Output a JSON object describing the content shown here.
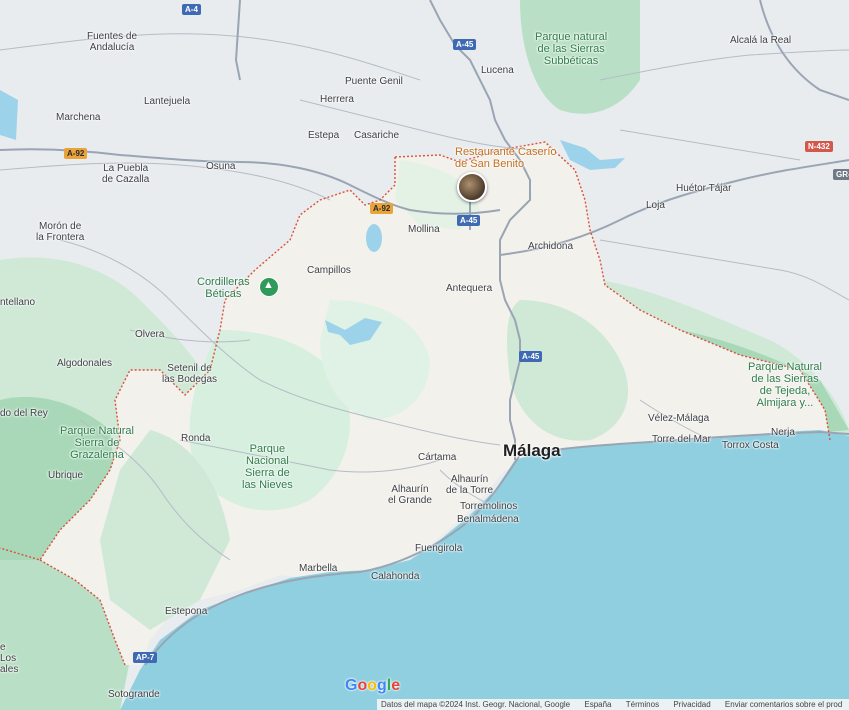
{
  "map": {
    "focus_city": "Málaga",
    "colors": {
      "sea": "#8fcfe0",
      "land": "#e9ecef",
      "province": "#f3f1ec",
      "green": "#bfe6cf",
      "dark_green": "#9fd5b2",
      "road": "#9aa5b4",
      "border": "#d9503c",
      "water": "#9dd3ea"
    },
    "cities": [
      {
        "id": "malaga",
        "name": "Málaga"
      },
      {
        "id": "antequera",
        "name": "Antequera"
      },
      {
        "id": "marbella",
        "name": "Marbella"
      },
      {
        "id": "ronda",
        "name": "Ronda"
      },
      {
        "id": "velez",
        "name": "Vélez-Málaga"
      },
      {
        "id": "torremolinos",
        "name": "Torremolinos"
      },
      {
        "id": "benalmadena",
        "name": "Benalmádena"
      },
      {
        "id": "fuengirola",
        "name": "Fuengirola"
      },
      {
        "id": "calahonda",
        "name": "Calahonda"
      },
      {
        "id": "estepona",
        "name": "Estepona"
      },
      {
        "id": "sotogrande",
        "name": "Sotogrande"
      },
      {
        "id": "cartama",
        "name": "Cártama"
      },
      {
        "id": "alhaurin_grande",
        "name": "Alhaurín\nel Grande"
      },
      {
        "id": "alhaurin_torre",
        "name": "Alhaurín\nde la Torre"
      },
      {
        "id": "nerja",
        "name": "Nerja"
      },
      {
        "id": "torre_mar",
        "name": "Torre del Mar"
      },
      {
        "id": "torrox",
        "name": "Torrox Costa"
      },
      {
        "id": "archidona",
        "name": "Archidona"
      },
      {
        "id": "mollina",
        "name": "Mollina"
      },
      {
        "id": "campillos",
        "name": "Campillos"
      },
      {
        "id": "olvera",
        "name": "Olvera"
      },
      {
        "id": "setenil",
        "name": "Setenil de\nlas Bodegas"
      },
      {
        "id": "algodonales",
        "name": "Algodonales"
      },
      {
        "id": "ubrique",
        "name": "Ubrique"
      },
      {
        "id": "huetor",
        "name": "Huétor Tájar"
      },
      {
        "id": "loja",
        "name": "Loja"
      },
      {
        "id": "alcala",
        "name": "Alcalá la Real"
      },
      {
        "id": "lucena",
        "name": "Lucena"
      },
      {
        "id": "puente_genil",
        "name": "Puente Genil"
      },
      {
        "id": "herrera",
        "name": "Herrera"
      },
      {
        "id": "estepa",
        "name": "Estepa"
      },
      {
        "id": "casariche",
        "name": "Casariche"
      },
      {
        "id": "osuna",
        "name": "Osuna"
      },
      {
        "id": "la_puebla",
        "name": "La Puebla\nde Cazalla"
      },
      {
        "id": "marchena",
        "name": "Marchena"
      },
      {
        "id": "lantejuela",
        "name": "Lantejuela"
      },
      {
        "id": "fuentes",
        "name": "Fuentes de\nAndalucía"
      },
      {
        "id": "moron",
        "name": "Morón de\nla Frontera"
      },
      {
        "id": "antellano",
        "name": "ntellano"
      },
      {
        "id": "rey",
        "name": "do del Rey"
      },
      {
        "id": "los",
        "name": "e\nLos\nales"
      },
      {
        "id": "loja_top",
        "name": "Loja"
      }
    ],
    "parks": [
      {
        "id": "subbeticas",
        "name": "Parque natural\nde las Sierras\nSubbéticas"
      },
      {
        "id": "cordilleras",
        "name": "Cordilleras\nBéticas"
      },
      {
        "id": "grazalema",
        "name": "Parque Natural\nSierra de\nGrazalema"
      },
      {
        "id": "nieves",
        "name": "Parque\nNacional\nSierra de\nlas Nieves"
      },
      {
        "id": "tejeda",
        "name": "Parque Natural\nde las Sierras\nde Tejeda,\nAlmijara y..."
      }
    ],
    "poi": {
      "name": "Restaurante Caserío\nde San Benito"
    },
    "roads": [
      {
        "id": "a4",
        "label": "A-4"
      },
      {
        "id": "a45_top",
        "label": "A-45"
      },
      {
        "id": "a92_left",
        "label": "A-92"
      },
      {
        "id": "a92_mid",
        "label": "A-92"
      },
      {
        "id": "a45_mid",
        "label": "A-45"
      },
      {
        "id": "a45_low",
        "label": "A-45"
      },
      {
        "id": "n432",
        "label": "N-432"
      },
      {
        "id": "gr",
        "label": "GR-"
      },
      {
        "id": "ap7",
        "label": "AP-7"
      }
    ],
    "branding": {
      "logo": "Google"
    },
    "footer": {
      "attribution": "Datos del mapa ©2024 Inst. Geogr. Nacional, Google",
      "country": "España",
      "terms": "Términos",
      "privacy": "Privacidad",
      "feedback": "Enviar comentarios sobre el prod"
    }
  }
}
